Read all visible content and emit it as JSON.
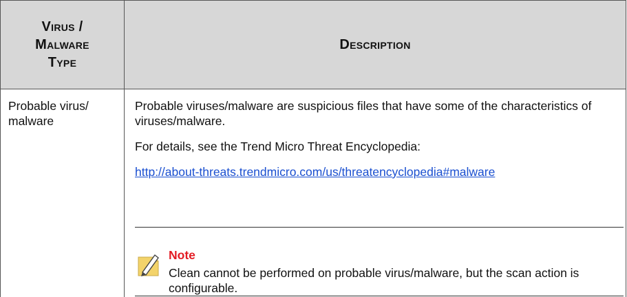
{
  "table": {
    "headers": {
      "type": "Virus /\nMalware\nType",
      "description": "Description"
    },
    "rows": [
      {
        "type": "Probable virus/\nmalware",
        "description": "Probable viruses/malware are suspicious files that have some of the characteristics of viruses/malware.",
        "details": "For details, see the Trend Micro Threat Encyclopedia:",
        "link": "http://about-threats.trendmicro.com/us/threatencyclopedia#malware",
        "note": {
          "title": "Note",
          "icon": "note-pencil-icon",
          "text": "Clean cannot be performed on probable virus/malware, but the scan action is configurable."
        }
      }
    ]
  },
  "colors": {
    "header_bg": "#d7d7d7",
    "link": "#1a4fd0",
    "note_title": "#e31b23",
    "note_icon": "#f3d36a"
  }
}
